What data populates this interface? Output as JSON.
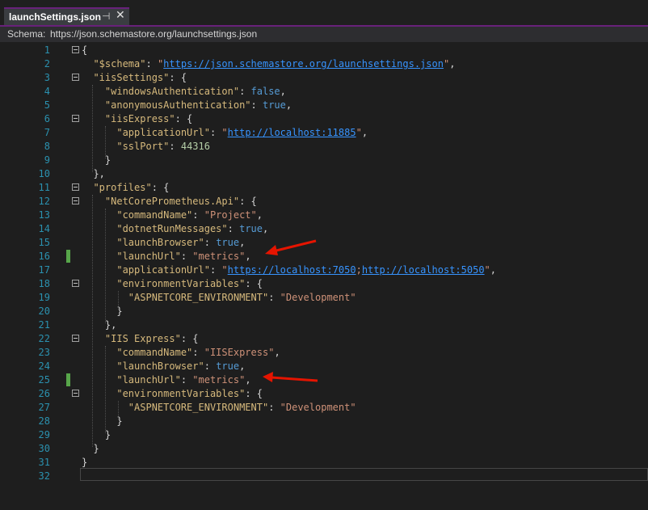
{
  "tab": {
    "title": "launchSettings.json",
    "pin_icon": "pin-icon",
    "close_icon": "close-icon"
  },
  "schema": {
    "label": "Schema:",
    "url": "https://json.schemastore.org/launchsettings.json"
  },
  "editor": {
    "line_numbers": [
      "1",
      "2",
      "3",
      "4",
      "5",
      "6",
      "7",
      "8",
      "9",
      "10",
      "11",
      "12",
      "13",
      "14",
      "15",
      "16",
      "17",
      "18",
      "19",
      "20",
      "21",
      "22",
      "23",
      "24",
      "25",
      "26",
      "27",
      "28",
      "29",
      "30",
      "31",
      "32"
    ],
    "changed_lines": [
      16,
      25
    ],
    "annotated_lines": [
      16,
      25
    ],
    "annotation_color": "#e51400",
    "lines": [
      "{",
      "  \"$schema\": \"https://json.schemastore.org/launchsettings.json\",",
      "  \"iisSettings\": {",
      "    \"windowsAuthentication\": false,",
      "    \"anonymousAuthentication\": true,",
      "    \"iisExpress\": {",
      "      \"applicationUrl\": \"http://localhost:11885\",",
      "      \"sslPort\": 44316",
      "    }",
      "  },",
      "  \"profiles\": {",
      "    \"NetCorePrometheus.Api\": {",
      "      \"commandName\": \"Project\",",
      "      \"dotnetRunMessages\": true,",
      "      \"launchBrowser\": true,",
      "      \"launchUrl\": \"metrics\",",
      "      \"applicationUrl\": \"https://localhost:7050;http://localhost:5050\",",
      "      \"environmentVariables\": {",
      "        \"ASPNETCORE_ENVIRONMENT\": \"Development\"",
      "      }",
      "    },",
      "    \"IIS Express\": {",
      "      \"commandName\": \"IISExpress\",",
      "      \"launchBrowser\": true,",
      "      \"launchUrl\": \"metrics\",",
      "      \"environmentVariables\": {",
      "        \"ASPNETCORE_ENVIRONMENT\": \"Development\"",
      "      }",
      "    }",
      "  }",
      "}",
      ""
    ]
  }
}
